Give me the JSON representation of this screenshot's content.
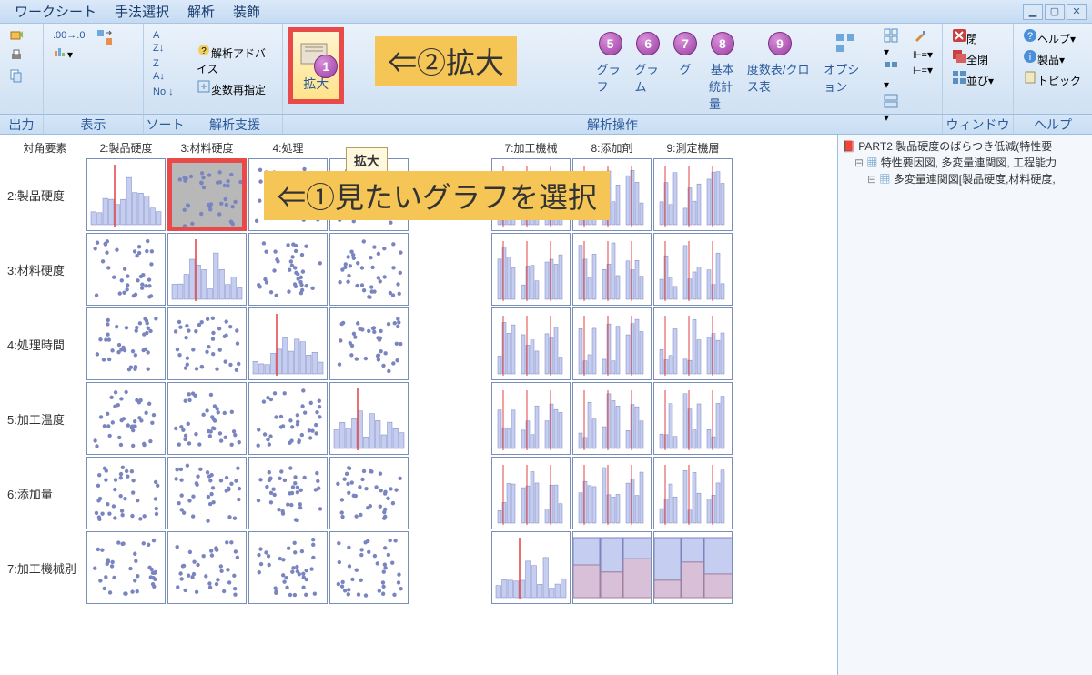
{
  "menu": {
    "items": [
      "ワークシート",
      "手法選択",
      "解析",
      "装飾"
    ]
  },
  "ribbon": {
    "groups": {
      "output": "出力",
      "display": "表示",
      "sort": "ソート",
      "analysis_support": "解析支援",
      "analysis_operation": "解析操作",
      "window": "ウィンドウ",
      "help": "ヘルプ"
    },
    "analysis_advice": "解析アドバイス",
    "var_respecify": "変数再指定",
    "zoom": "拡大",
    "graph": "グラフ",
    "gram": "グラム",
    "gu": "グ",
    "basic": "基本",
    "basic2": "統計量",
    "freq_cross": "度数表/クロス表",
    "option": "オプション",
    "close": "閉",
    "close_all": "全閉",
    "arrange": "並び",
    "help": "ヘルプ",
    "product": "製品",
    "topic": "トピック"
  },
  "tooltip": {
    "title": "拡大"
  },
  "callouts": {
    "c1": "⇐①見たいグラフを選択",
    "c2": "⇐②拡大"
  },
  "matrix": {
    "diag_label": "対角要素",
    "cols": [
      "2:製品硬度",
      "3:材料硬度",
      "4:処理",
      "",
      "",
      "7:加工機械",
      "8:添加剤",
      "9:測定機層"
    ],
    "rows": [
      "2:製品硬度",
      "3:材料硬度",
      "4:処理時間",
      "5:加工温度",
      "6:添加量",
      "7:加工機械別"
    ]
  },
  "tree": {
    "root": "PART2 製品硬度のばらつき低減(特性要",
    "child1": "特性要因図, 多変量連関図, 工程能力",
    "child2": "多変量連関図[製品硬度,材料硬度,"
  },
  "chart_data": {
    "type": "scatter-matrix",
    "note": "Scatter-plot matrix with histograms on diagonal and grouped bar/box plots in right columns. Values approximate.",
    "variables": [
      "製品硬度",
      "材料硬度",
      "処理時間",
      "加工温度",
      "添加量",
      "加工機械",
      "添加剤",
      "測定機層"
    ],
    "diagonal_histogram_bins": 12,
    "points_per_cell_approx": 40
  }
}
